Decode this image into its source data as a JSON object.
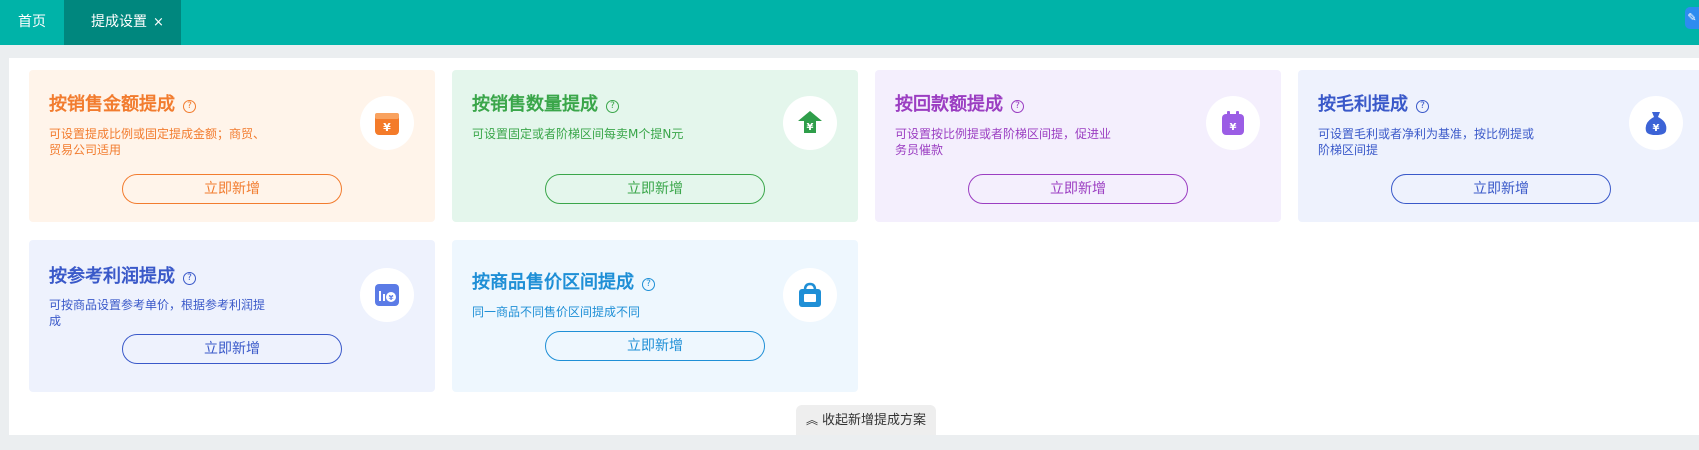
{
  "tabs": {
    "home_label": "首页",
    "active_label": "提成设置",
    "close_glyph": "×"
  },
  "cards": [
    {
      "title": "按销售金额提成",
      "desc": "可设置提成比例或固定提成金额；商贸、贸易公司适用",
      "button": "立即新增",
      "icon": "orange-wallet-icon",
      "color": "#f27c2f",
      "bg": "#fff4ea"
    },
    {
      "title": "按销售数量提成",
      "desc": "可设置固定或者阶梯区间每卖M个提N元",
      "button": "立即新增",
      "icon": "green-money-icon",
      "color": "#3aa64a",
      "bg": "#e4f6ec"
    },
    {
      "title": "按回款额提成",
      "desc": "可设置按比例提或者阶梯区间提，促进业务员催款",
      "button": "立即新增",
      "icon": "purple-calendar-icon",
      "color": "#9b3ec2",
      "bg": "#f4effd"
    },
    {
      "title": "按毛利提成",
      "desc": "可设置毛利或者净利为基准，按比例提或阶梯区间提",
      "button": "立即新增",
      "icon": "blue-moneybag-icon",
      "color": "#3a59c9",
      "bg": "#eef2fd"
    },
    {
      "title": "按参考利润提成",
      "desc": "可按商品设置参考单价，根据参考利润提成",
      "button": "立即新增",
      "icon": "blue-chart-icon",
      "color": "#3a59c9",
      "bg": "#eef2fd"
    },
    {
      "title": "按商品售价区间提成",
      "desc": "同一商品不同售价区间提成不同",
      "button": "立即新增",
      "icon": "blue-bag-icon",
      "color": "#1f8fd6",
      "bg": "#eef7fe"
    }
  ],
  "collapse_label": "收起新增提成方案",
  "help_glyph": "?"
}
